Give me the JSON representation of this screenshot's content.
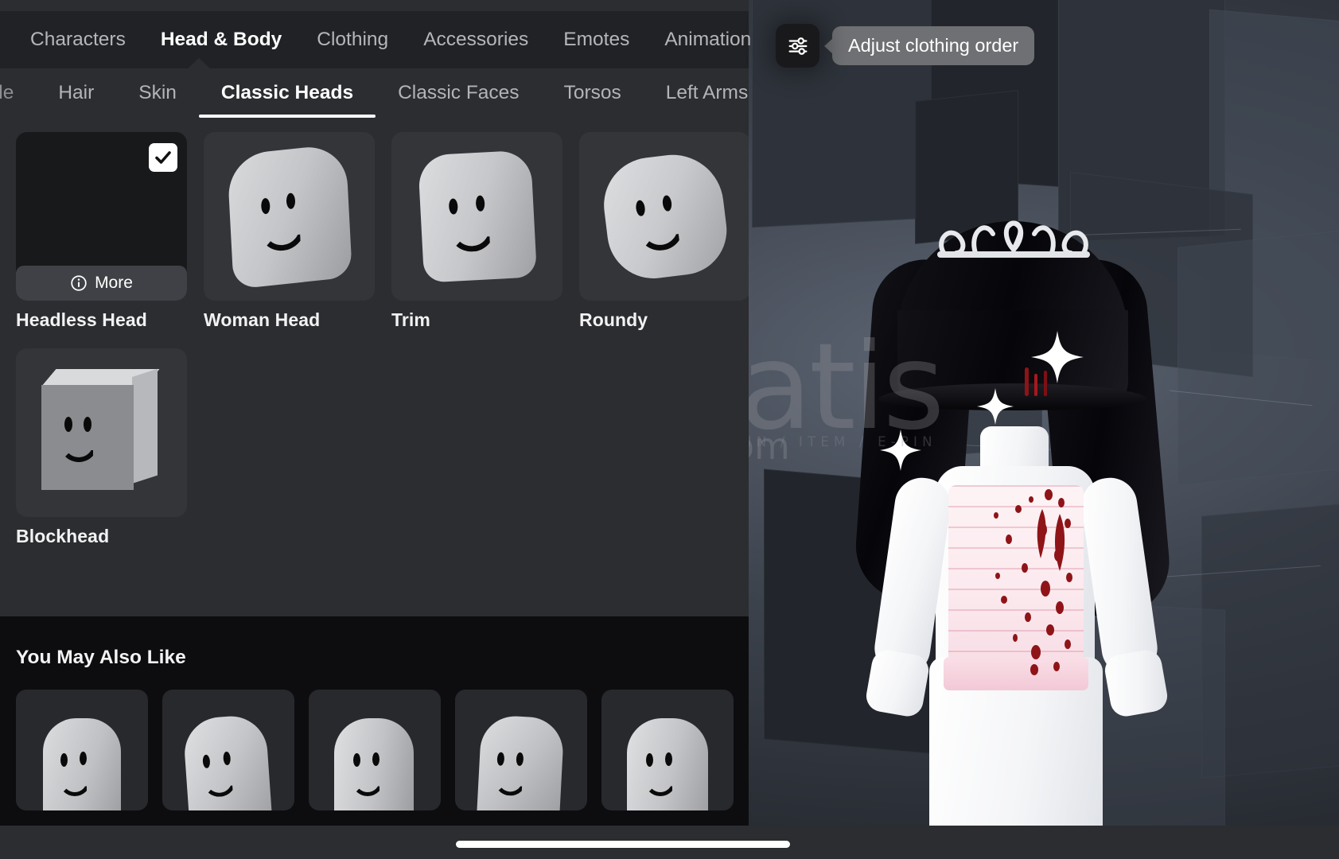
{
  "app": {
    "name": "roblox-avatar-editor"
  },
  "primary_tabs": [
    {
      "label": "Characters",
      "active": false
    },
    {
      "label": "Head & Body",
      "active": true
    },
    {
      "label": "Clothing",
      "active": false
    },
    {
      "label": "Accessories",
      "active": false
    },
    {
      "label": "Emotes",
      "active": false
    },
    {
      "label": "Animation",
      "active": false
    }
  ],
  "secondary_tabs": [
    {
      "label": "yle",
      "active": false,
      "truncated": true
    },
    {
      "label": "Hair",
      "active": false
    },
    {
      "label": "Skin",
      "active": false
    },
    {
      "label": "Classic Heads",
      "active": true
    },
    {
      "label": "Classic Faces",
      "active": false
    },
    {
      "label": "Torsos",
      "active": false
    },
    {
      "label": "Left Arms",
      "active": false
    }
  ],
  "items": [
    {
      "label": "Headless Head",
      "selected": true,
      "more_label": "More",
      "thumb": "empty"
    },
    {
      "label": "Woman Head",
      "selected": false,
      "thumb": "woman-head"
    },
    {
      "label": "Trim",
      "selected": false,
      "thumb": "trim-head"
    },
    {
      "label": "Roundy",
      "selected": false,
      "thumb": "roundy-head"
    },
    {
      "label": "Blockhead",
      "selected": false,
      "thumb": "block-head"
    }
  ],
  "recommendations": {
    "title": "You May Also Like",
    "items": [
      {
        "thumb": "classic-head-1"
      },
      {
        "thumb": "classic-head-2"
      },
      {
        "thumb": "classic-head-3"
      },
      {
        "thumb": "classic-head-4"
      },
      {
        "thumb": "classic-head-5"
      }
    ]
  },
  "adjust_button": {
    "icon": "sliders-icon",
    "tooltip": "Adjust clothing order"
  },
  "watermark": {
    "text": "itemsatis",
    "subtitle": "HESAP / SKIN / ITEM / E-PIN",
    "suffix": ".com"
  },
  "colors": {
    "panel_bg": "#2b2d30",
    "tabbar_bg": "#212225",
    "card_bg": "#333539",
    "selected_card_bg": "#18191b",
    "recommend_bg": "#0d0d0f",
    "accent_text": "#ffffff",
    "muted_text": "#b5b6b9",
    "tooltip_bg": "#6f7073"
  }
}
